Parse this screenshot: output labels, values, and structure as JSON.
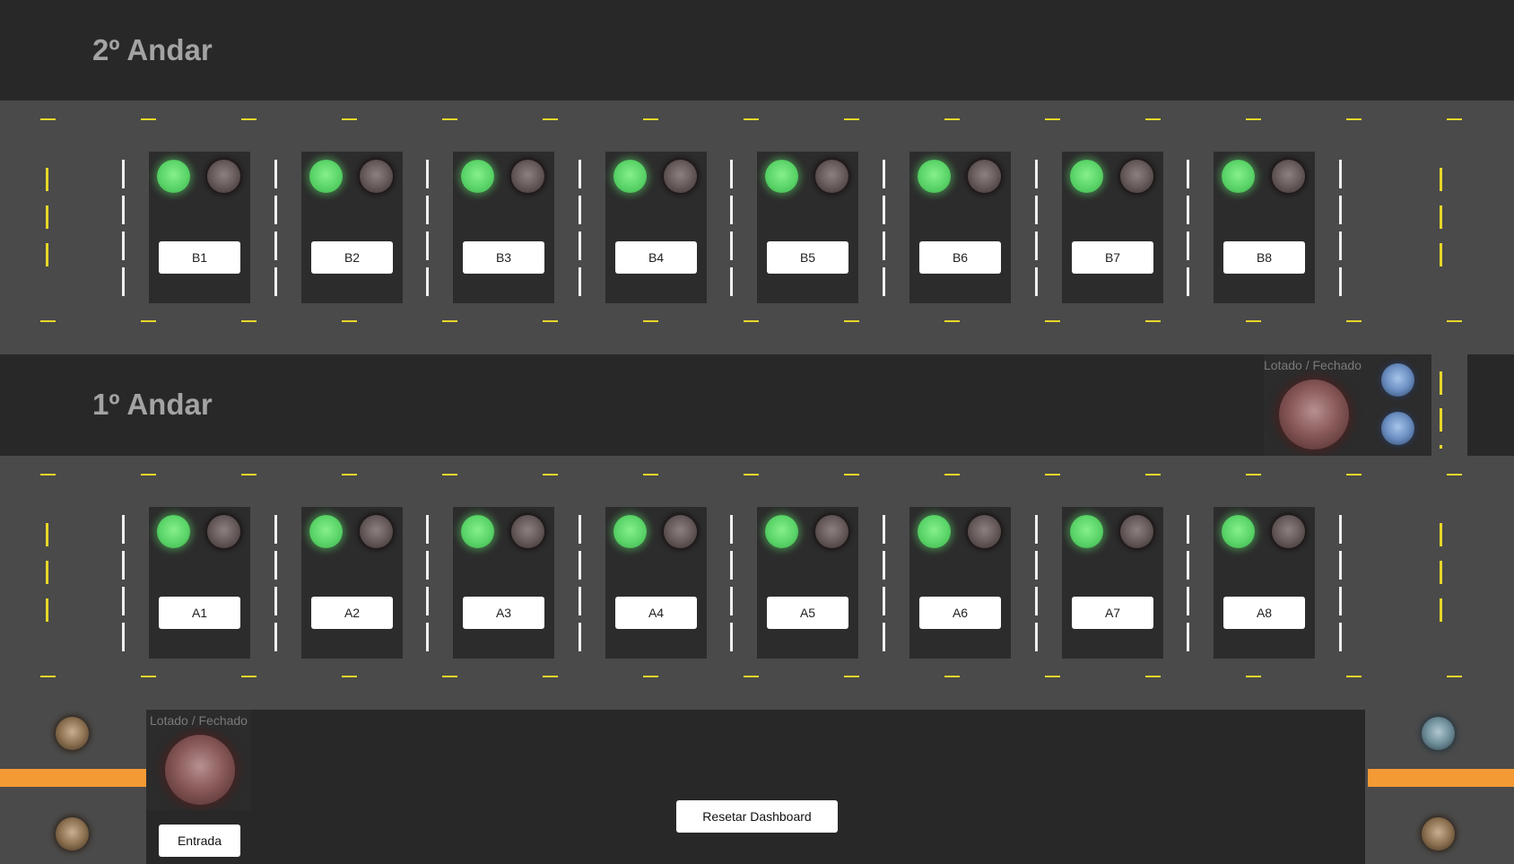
{
  "floors": {
    "floor2": {
      "title": "2º Andar",
      "spots": [
        {
          "label": "B1",
          "free": true
        },
        {
          "label": "B2",
          "free": true
        },
        {
          "label": "B3",
          "free": true
        },
        {
          "label": "B4",
          "free": true
        },
        {
          "label": "B5",
          "free": true
        },
        {
          "label": "B6",
          "free": true
        },
        {
          "label": "B7",
          "free": true
        },
        {
          "label": "B8",
          "free": true
        }
      ]
    },
    "floor1": {
      "title": "1º Andar",
      "spots": [
        {
          "label": "A1",
          "free": true
        },
        {
          "label": "A2",
          "free": true
        },
        {
          "label": "A3",
          "free": true
        },
        {
          "label": "A4",
          "free": true
        },
        {
          "label": "A5",
          "free": true
        },
        {
          "label": "A6",
          "free": true
        },
        {
          "label": "A7",
          "free": true
        },
        {
          "label": "A8",
          "free": true
        }
      ]
    }
  },
  "ramp_status": {
    "label": "Lotado / Fechado"
  },
  "entrance_status": {
    "label": "Lotado / Fechado"
  },
  "entrance_button": {
    "label": "Entrada"
  },
  "reset_button": {
    "label": "Resetar Dashboard"
  },
  "colors": {
    "background": "#282828",
    "lane": "#4a4a4a",
    "lane_marking": "#e8d72a",
    "free_led": "#5ad468",
    "gate_bar": "#f39a35"
  }
}
